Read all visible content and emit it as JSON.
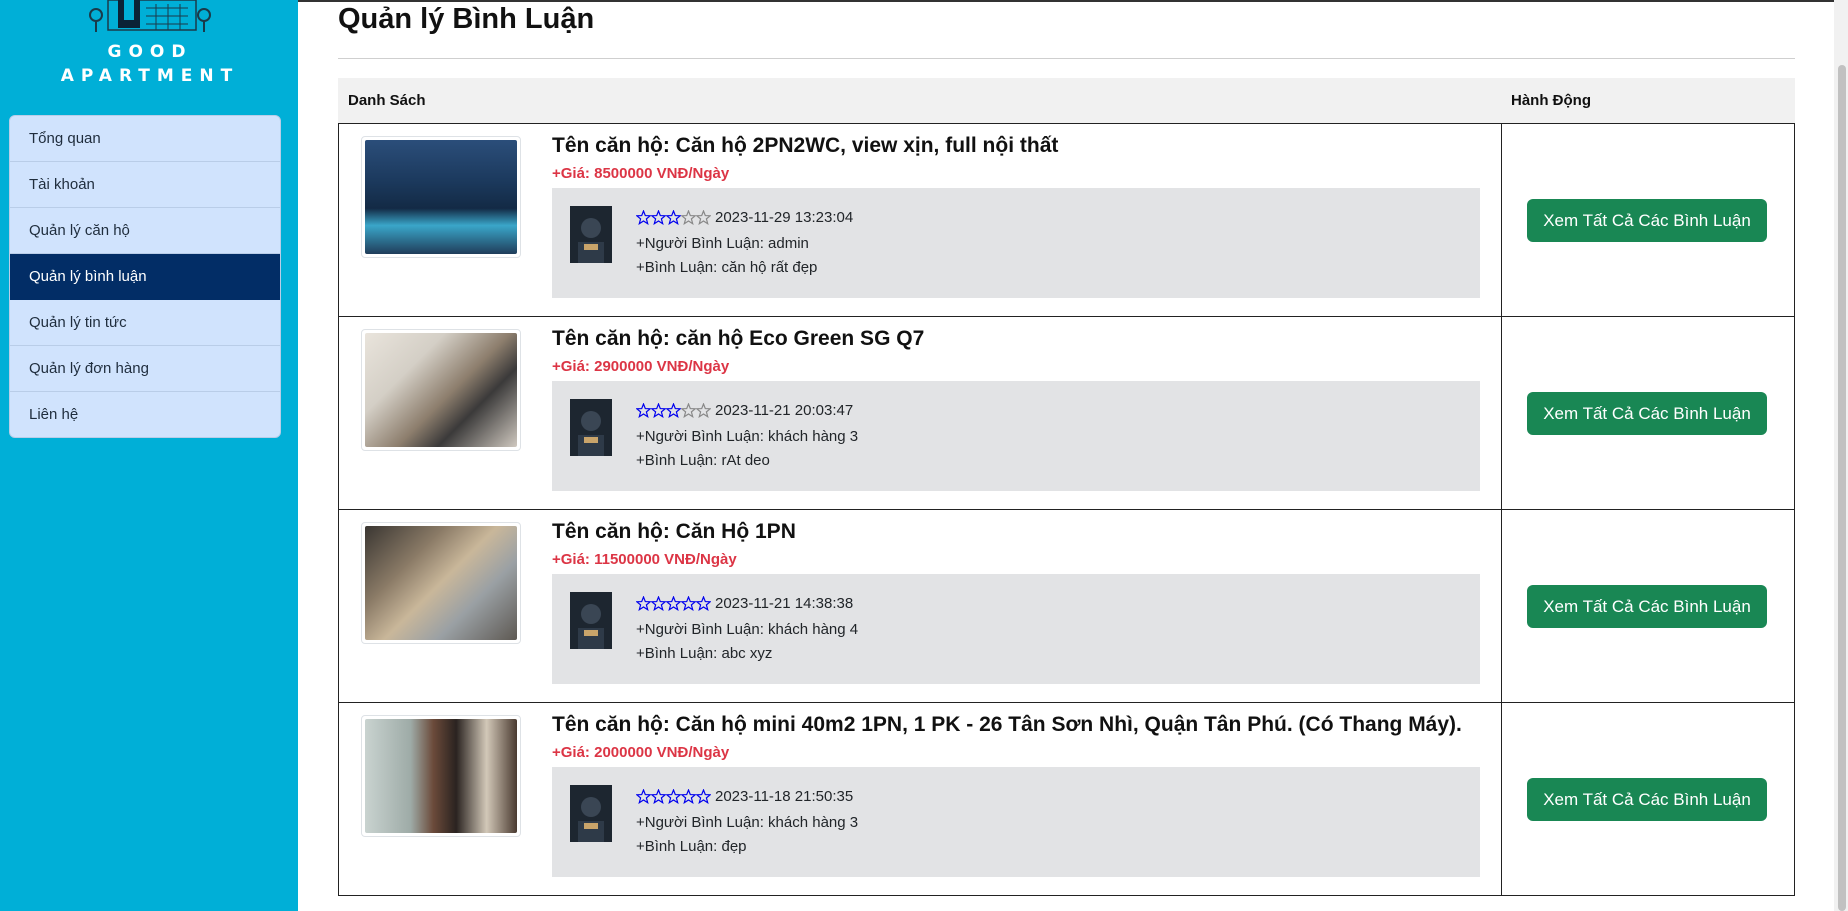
{
  "sidebar": {
    "brand_line1": "GOOD",
    "brand_line2": "APARTMENT",
    "items": [
      {
        "label": "Tổng quan",
        "active": false
      },
      {
        "label": "Tài khoản",
        "active": false
      },
      {
        "label": "Quản lý căn hộ",
        "active": false
      },
      {
        "label": "Quản lý bình luận",
        "active": true
      },
      {
        "label": "Quản lý tin tức",
        "active": false
      },
      {
        "label": "Quản lý đơn hàng",
        "active": false
      },
      {
        "label": "Liên hệ",
        "active": false
      }
    ]
  },
  "main": {
    "title": "Quản lý Bình Luận",
    "table": {
      "col_list": "Danh Sách",
      "col_action": "Hành Động",
      "rows": [
        {
          "name": "Tên căn hộ: Căn hộ 2PN2WC, view xịn, full nội thất",
          "price": "+Giá: 8500000 VNĐ/Ngày",
          "rating": 3,
          "date": "2023-11-29 13:23:04",
          "commenter": "+Người Bình Luận: admin",
          "comment": "+Bình Luận: căn hộ rất đẹp",
          "button": "Xem Tất Cả Các Bình Luận"
        },
        {
          "name": "Tên căn hộ: căn hộ Eco Green SG Q7",
          "price": "+Giá: 2900000 VNĐ/Ngày",
          "rating": 3,
          "date": "2023-11-21 20:03:47",
          "commenter": "+Người Bình Luận: khách hàng 3",
          "comment": "+Bình Luận: rAt deo",
          "button": "Xem Tất Cả Các Bình Luận"
        },
        {
          "name": "Tên căn hộ: Căn Hộ 1PN",
          "price": "+Giá: 11500000 VNĐ/Ngày",
          "rating": 5,
          "date": "2023-11-21 14:38:38",
          "commenter": "+Người Bình Luận: khách hàng 4",
          "comment": "+Bình Luận: abc xyz",
          "button": "Xem Tất Cả Các Bình Luận"
        },
        {
          "name": "Tên căn hộ: Căn hộ mini 40m2 1PN, 1 PK - 26 Tân Sơn Nhì, Quận Tân Phú. (Có Thang Máy).",
          "price": "+Giá: 2000000 VNĐ/Ngày",
          "rating": 5,
          "date": "2023-11-18 21:50:35",
          "commenter": "+Người Bình Luận: khách hàng 3",
          "comment": "+Bình Luận: đẹp",
          "button": "Xem Tất Cả Các Bình Luận"
        }
      ]
    }
  },
  "colors": {
    "sidebar_bg": "#00afd7",
    "menu_active": "#022d66",
    "price_red": "#dc3545",
    "button_green": "#198754",
    "star_blue": "#0000ee"
  }
}
